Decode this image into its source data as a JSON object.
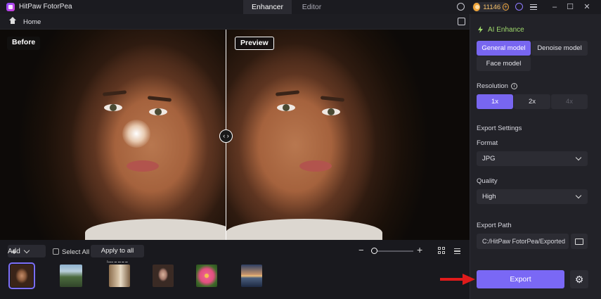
{
  "window": {
    "app_title": "HitPaw FotorPea",
    "minimize": "–",
    "maximize": "☐",
    "close": "✕"
  },
  "tabs": [
    {
      "label": "Enhancer",
      "active": true
    },
    {
      "label": "Editor",
      "active": false
    }
  ],
  "coins": {
    "count": "11146",
    "plus": "+"
  },
  "breadcrumb": {
    "home": "Home"
  },
  "viewer": {
    "before_label": "Before",
    "preview_label": "Preview",
    "handle": "‹ ›"
  },
  "toolbar": {
    "add_label": "Add",
    "select_all_label": "Select All",
    "apply_all_label": "Apply to all images",
    "zoom_minus": "−",
    "zoom_plus": "+"
  },
  "thumbnails": [
    {
      "name": "portrait-curly-hair",
      "selected": true
    },
    {
      "name": "mountain-landscape",
      "selected": false
    },
    {
      "name": "city-street",
      "selected": false
    },
    {
      "name": "portrait-woman",
      "selected": false
    },
    {
      "name": "pink-flower",
      "selected": false
    },
    {
      "name": "sunset-sea",
      "selected": false
    }
  ],
  "panel": {
    "section_title": "AI Enhance",
    "models": [
      {
        "label": "General model",
        "active": true
      },
      {
        "label": "Denoise model",
        "active": false
      },
      {
        "label": "Face model",
        "active": false
      }
    ],
    "resolution_label": "Resolution",
    "resolutions": [
      {
        "label": "1x",
        "active": true
      },
      {
        "label": "2x",
        "active": false
      },
      {
        "label": "4x",
        "disabled": true
      }
    ],
    "export_settings_label": "Export Settings",
    "format_label": "Format",
    "format_value": "JPG",
    "quality_label": "Quality",
    "quality_value": "High",
    "export_path_label": "Export Path",
    "export_path_value": "C:/HitPaw FotorPea/Exported",
    "export_button": "Export",
    "gear": "⚙"
  },
  "colors": {
    "accent": "#7866f0",
    "section_title": "#9ed86b",
    "arrow": "#e01b1b"
  }
}
